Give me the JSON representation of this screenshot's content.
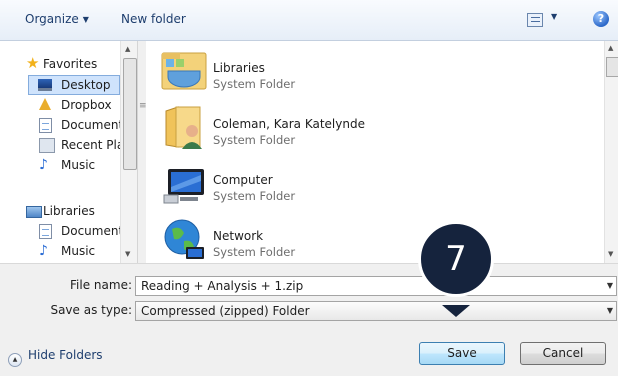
{
  "toolbar": {
    "organize_label": "Organize",
    "new_folder_label": "New folder",
    "help_label": "?"
  },
  "nav": {
    "favorites": "Favorites",
    "desktop": "Desktop",
    "dropbox": "Dropbox",
    "documents": "Documents",
    "recent_places": "Recent Plac",
    "music": "Music",
    "libraries": "Libraries",
    "lib_documents": "Documents",
    "lib_music": "Music"
  },
  "files": [
    {
      "name": "Libraries",
      "type": "System Folder"
    },
    {
      "name": "Coleman, Kara Katelynde",
      "type": "System Folder"
    },
    {
      "name": "Computer",
      "type": "System Folder"
    },
    {
      "name": "Network",
      "type": "System Folder"
    }
  ],
  "form": {
    "file_name_label": "File name:",
    "file_name_value": "Reading + Analysis + 1.zip",
    "save_type_label": "Save as type:",
    "save_type_value": "Compressed (zipped) Folder"
  },
  "footer": {
    "hide_folders_label": "Hide Folders",
    "save_label": "Save",
    "cancel_label": "Cancel"
  },
  "callout": {
    "step_number": "7"
  },
  "colors": {
    "callout_fill": "#15233d",
    "selected_nav": "#cfe3fc"
  }
}
